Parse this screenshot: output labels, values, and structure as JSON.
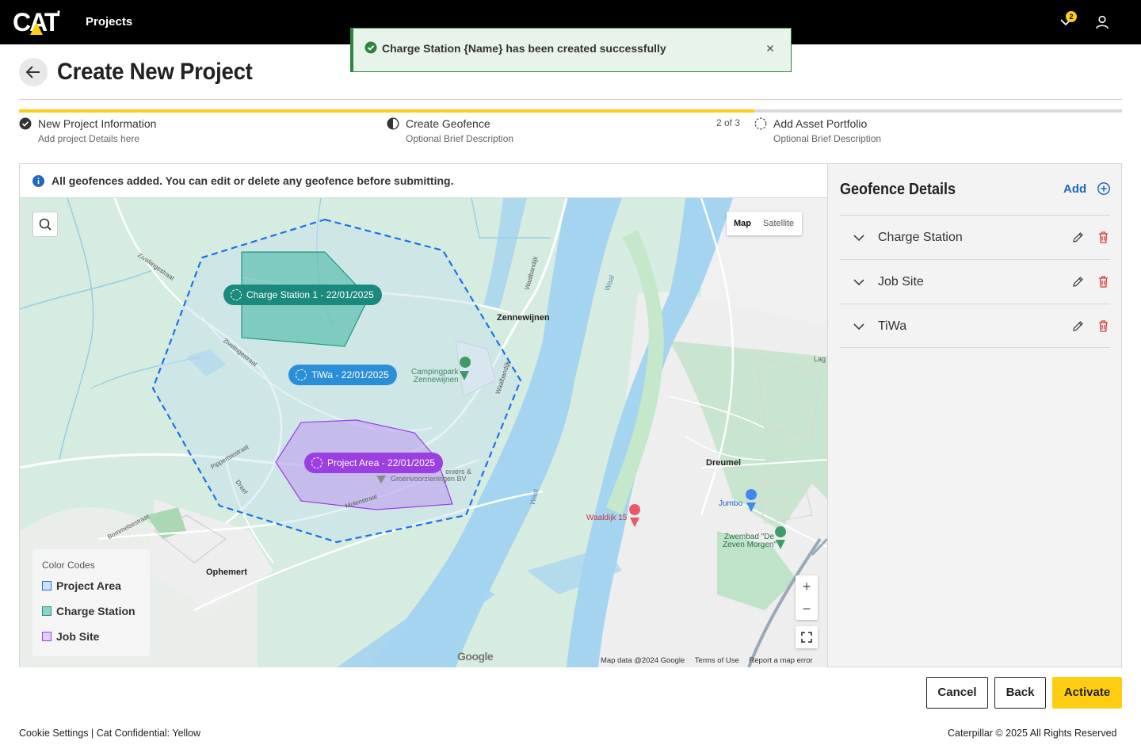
{
  "app": {
    "nav_title": "Projects",
    "notification_count": "2",
    "accent_color": "#ffcd11"
  },
  "header": {
    "title": "Create New Project"
  },
  "toast": {
    "message": "Charge Station {Name} has been created successfully",
    "color": "#2e8540"
  },
  "stepper": {
    "progress_fraction": 0.667,
    "count_label": "2 of 3",
    "steps": [
      {
        "title": "New Project Information",
        "subtitle": "Add project Details here",
        "state": "complete"
      },
      {
        "title": "Create Geofence",
        "subtitle": "Optional Brief Description",
        "state": "in-progress"
      },
      {
        "title": "Add Asset Portfolio",
        "subtitle": "Optional Brief Description",
        "state": "pending"
      }
    ]
  },
  "info_banner": {
    "text": "All geofences added. You can edit or delete any geofence before submitting."
  },
  "map": {
    "toggle": {
      "map": "Map",
      "satellite": "Satellite",
      "selected": "Map"
    },
    "labels": {
      "charge_station": "Charge Station 1 - 22/01/2025",
      "tiwa": "TiWa - 22/01/2025",
      "project_area": "Project Area - 22/01/2025"
    },
    "places": {
      "zennewijnen": "Zennewijnen",
      "campingpark": "Campingpark",
      "campingpark2": "Zennewijnen",
      "dreumel": "Dreumel",
      "ophemert": "Ophemert",
      "jumbo": "Jumbo",
      "waaldijk": "Waaldijk 15",
      "zwembad": "Zwembad \"De",
      "zwembad2": "Zeven Morgen\"",
      "hoveniers": "eniers &",
      "hoveniers2": "Groenvoorzieningen BV",
      "waal1": "Waal",
      "waal2": "Waal",
      "lag": "Lag",
      "street1": "Ziveliingestraat",
      "street2": "Zivelingestraat",
      "street3": "Waalbandijk",
      "street4": "Waalbandijk",
      "street5": "Pippertsestraat",
      "street6": "Dreef",
      "street7": "Molenstraat",
      "street8": "Bommelsestraat"
    },
    "google": "Google",
    "footer": {
      "data": "Map data @2024 Google",
      "terms": "Terms of Use",
      "report": "Report a map error"
    },
    "zoom_in": "+",
    "zoom_out": "−",
    "legend": {
      "title": "Color Codes",
      "items": [
        {
          "label": "Project Area",
          "color": "#1a73e8"
        },
        {
          "label": "Charge Station",
          "color": "#1a9a8a"
        },
        {
          "label": "Job Site",
          "color": "#9b3fe0"
        }
      ]
    }
  },
  "geofence_panel": {
    "title": "Geofence Details",
    "add_label": "Add",
    "items": [
      {
        "name": "Charge Station"
      },
      {
        "name": "Job Site"
      },
      {
        "name": "TiWa"
      }
    ]
  },
  "actions": {
    "cancel": "Cancel",
    "back": "Back",
    "activate": "Activate"
  },
  "footer": {
    "left": "Cookie Settings | Cat Confidential: Yellow",
    "right": "Caterpillar © 2025 All Rights Reserved"
  }
}
